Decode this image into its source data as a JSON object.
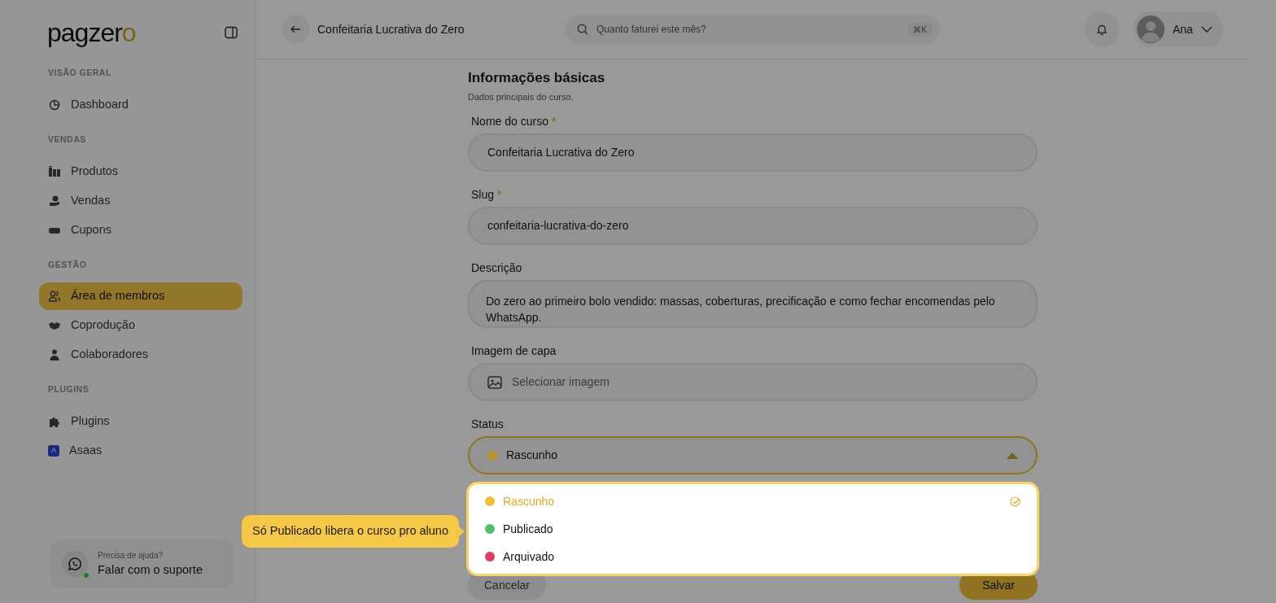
{
  "sidebar": {
    "logo": {
      "text": "pagzer",
      "accent": "o"
    },
    "sections": [
      {
        "title": "VISÃO GERAL",
        "items": [
          {
            "label": "Dashboard",
            "selected": false
          }
        ]
      },
      {
        "title": "VENDAS",
        "items": [
          {
            "label": "Produtos",
            "selected": false
          },
          {
            "label": "Vendas",
            "selected": false
          },
          {
            "label": "Cupons",
            "selected": false
          }
        ]
      },
      {
        "title": "GESTÃO",
        "items": [
          {
            "label": "Área de membros",
            "selected": true
          },
          {
            "label": "Coprodução",
            "selected": false
          },
          {
            "label": "Colaboradores",
            "selected": false
          }
        ]
      },
      {
        "title": "PLUGINS",
        "items": [
          {
            "label": "Plugins",
            "selected": false
          },
          {
            "label": "Asaas",
            "selected": false,
            "badge": "A"
          }
        ]
      }
    ],
    "help": {
      "subtitle": "Precisa de ajuda?",
      "title": "Falar com o suporte",
      "online": true
    }
  },
  "header": {
    "title": "Confeitaria Lucrativa do Zero",
    "search": {
      "placeholder": "Quanto faturei este mês?",
      "shortcut": "⌘K"
    },
    "user": "Ana"
  },
  "form": {
    "title": "Informações básicas",
    "subtitle": "Dados principais do curso.",
    "fields": [
      {
        "kind": "text",
        "label": "Nome do curso",
        "required_mark": "*",
        "value": "Confeitaria Lucrativa do Zero"
      },
      {
        "kind": "text",
        "label": "Slug",
        "required_mark": "*",
        "value": "confeitaria-lucrativa-do-zero"
      },
      {
        "kind": "textarea",
        "label": "Descrição",
        "value": "Do zero ao primeiro bolo vendido: massas, coberturas, precificação e como fechar encomendas pelo WhatsApp."
      },
      {
        "kind": "image",
        "label": "Imagem de capa",
        "placeholder": "Selecionar imagem"
      },
      {
        "kind": "select",
        "label": "Status",
        "value": "Rascunho",
        "color": "#b8932f",
        "expanded": true,
        "options": [
          {
            "label": "Rascunho",
            "color": "#f0bf3a",
            "selected": true
          },
          {
            "label": "Publicado",
            "color": "#4cc265",
            "selected": false
          },
          {
            "label": "Arquivado",
            "color": "#e23b63",
            "selected": false
          }
        ],
        "tooltip": "Só Publicado libera o curso pro aluno"
      }
    ],
    "buttons": [
      {
        "kind": "secondary",
        "label": "Cancelar"
      },
      {
        "kind": "primary",
        "label": "Salvar"
      }
    ]
  }
}
